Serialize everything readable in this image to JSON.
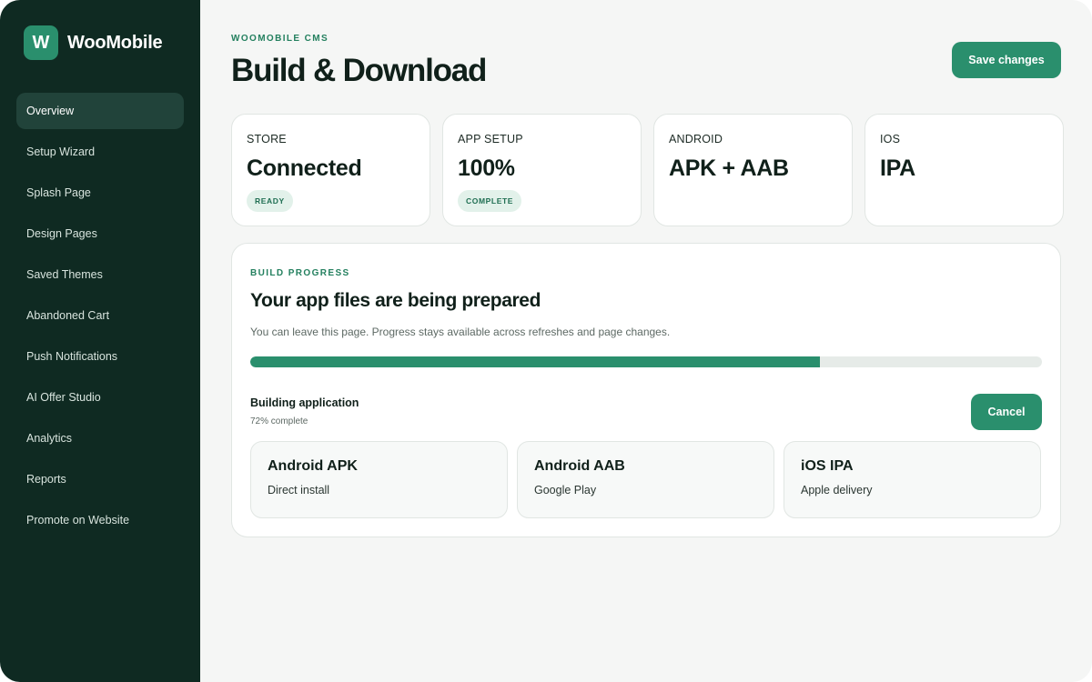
{
  "brand": {
    "logo_letter": "W",
    "name": "WooMobile"
  },
  "sidebar": {
    "items": [
      {
        "label": "Overview",
        "active": true
      },
      {
        "label": "Setup Wizard"
      },
      {
        "label": "Splash Page"
      },
      {
        "label": "Design Pages"
      },
      {
        "label": "Saved Themes"
      },
      {
        "label": "Abandoned Cart"
      },
      {
        "label": "Push Notifications"
      },
      {
        "label": "AI Offer Studio"
      },
      {
        "label": "Analytics"
      },
      {
        "label": "Reports"
      },
      {
        "label": "Promote on Website"
      }
    ]
  },
  "header": {
    "eyebrow": "WOOMOBILE CMS",
    "title": "Build & Download",
    "save_label": "Save changes"
  },
  "stats": [
    {
      "label": "STORE",
      "value": "Connected",
      "badge": "READY"
    },
    {
      "label": "APP SETUP",
      "value": "100%",
      "badge": "COMPLETE"
    },
    {
      "label": "ANDROID",
      "value": "APK + AAB"
    },
    {
      "label": "IOS",
      "value": "IPA"
    }
  ],
  "build": {
    "eyebrow": "BUILD PROGRESS",
    "title": "Your app files are being prepared",
    "description": "You can leave this page. Progress stays available across refreshes and page changes.",
    "progress_percent": 72,
    "status_title": "Building application",
    "status_sub": "72% complete",
    "cancel_label": "Cancel",
    "artifacts": [
      {
        "name": "Android APK",
        "desc": "Direct install"
      },
      {
        "name": "Android AAB",
        "desc": "Google Play"
      },
      {
        "name": "iOS IPA",
        "desc": "Apple delivery"
      }
    ]
  },
  "colors": {
    "accent": "#2a8f6d",
    "sidebar_bg": "#0f2a22",
    "badge_bg": "#e2f1ea"
  }
}
